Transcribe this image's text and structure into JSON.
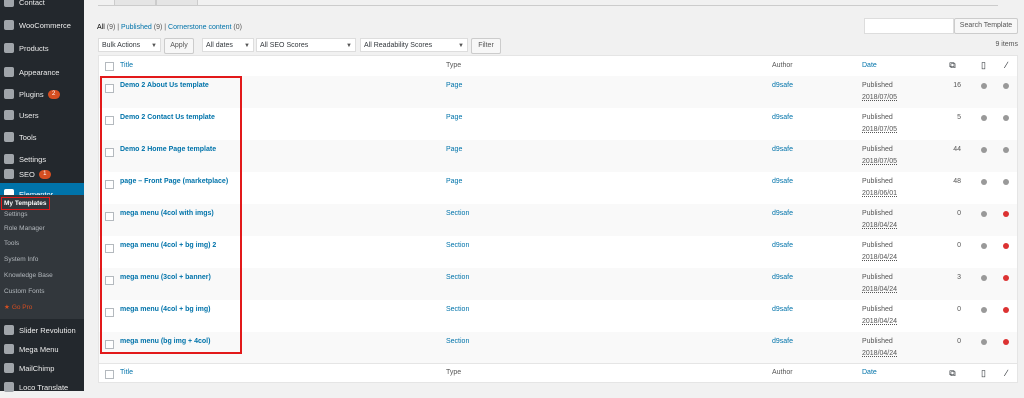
{
  "sidebar": {
    "items": [
      {
        "label": "Contact",
        "name": "sidebar-item-contact",
        "icon": "mail-icon"
      },
      {
        "label": "WooCommerce",
        "name": "sidebar-item-woocommerce",
        "icon": "woocommerce-icon"
      },
      {
        "label": "Products",
        "name": "sidebar-item-products",
        "icon": "archive-icon"
      },
      {
        "label": "Appearance",
        "name": "sidebar-item-appearance",
        "icon": "brush-icon"
      },
      {
        "label": "Plugins",
        "name": "sidebar-item-plugins",
        "icon": "plug-icon",
        "badge": "2"
      },
      {
        "label": "Users",
        "name": "sidebar-item-users",
        "icon": "user-icon"
      },
      {
        "label": "Tools",
        "name": "sidebar-item-tools",
        "icon": "wrench-icon"
      },
      {
        "label": "Settings",
        "name": "sidebar-item-settings",
        "icon": "settings-icon"
      },
      {
        "label": "SEO",
        "name": "sidebar-item-seo",
        "icon": "yoast-icon",
        "badge": "1"
      },
      {
        "label": "Elementor",
        "name": "sidebar-item-elementor",
        "icon": "elementor-icon",
        "active": true
      }
    ],
    "submenu": [
      "My Templates",
      "Settings",
      "Role Manager",
      "Tools",
      "System Info",
      "Knowledge Base",
      "Custom Fonts",
      "Go Pro"
    ],
    "bottom_items": [
      {
        "label": "Slider Revolution",
        "icon": "slider-icon"
      },
      {
        "label": "Mega Menu",
        "icon": "megamenu-icon"
      },
      {
        "label": "MailChimp",
        "icon": "mailchimp-icon"
      },
      {
        "label": "Loco Translate",
        "icon": "translate-icon"
      }
    ]
  },
  "filters_links": {
    "all": "All",
    "all_count": "(9)",
    "sep1": "|",
    "published": "Published",
    "published_count": "(9)",
    "sep2": "|",
    "cornerstone": "Cornerstone content",
    "cornerstone_count": "(0)"
  },
  "toolbar": {
    "bulk_actions": "Bulk Actions",
    "apply": "Apply",
    "dates": "All dates",
    "seo": "All SEO Scores",
    "readability": "All Readability Scores",
    "filter": "Filter",
    "search_button": "Search Template",
    "items_count": "9 items"
  },
  "table": {
    "columns": {
      "title": "Title",
      "type": "Type",
      "author": "Author",
      "date": "Date"
    },
    "rows": [
      {
        "title": "Demo 2 About Us template",
        "type": "Page",
        "author": "d9safe",
        "status": "Published",
        "date": "2018/07/05",
        "links": "16",
        "seo": "#999999",
        "read": "#999999"
      },
      {
        "title": "Demo 2 Contact Us template",
        "type": "Page",
        "author": "d9safe",
        "status": "Published",
        "date": "2018/07/05",
        "links": "5",
        "seo": "#999999",
        "read": "#999999"
      },
      {
        "title": "Demo 2 Home Page template",
        "type": "Page",
        "author": "d9safe",
        "status": "Published",
        "date": "2018/07/05",
        "links": "44",
        "seo": "#999999",
        "read": "#999999"
      },
      {
        "title": "page – Front Page (marketplace)",
        "type": "Page",
        "author": "d9safe",
        "status": "Published",
        "date": "2018/06/01",
        "links": "48",
        "seo": "#999999",
        "read": "#999999"
      },
      {
        "title": "mega menu (4col with imgs)",
        "type": "Section",
        "author": "d9safe",
        "status": "Published",
        "date": "2018/04/24",
        "links": "0",
        "seo": "#999999",
        "read": "#dc3232"
      },
      {
        "title": "mega menu (4col + bg img) 2",
        "type": "Section",
        "author": "d9safe",
        "status": "Published",
        "date": "2018/04/24",
        "links": "0",
        "seo": "#999999",
        "read": "#dc3232"
      },
      {
        "title": "mega menu (3col + banner)",
        "type": "Section",
        "author": "d9safe",
        "status": "Published",
        "date": "2018/04/24",
        "links": "3",
        "seo": "#999999",
        "read": "#dc3232"
      },
      {
        "title": "mega menu (4col + bg img)",
        "type": "Section",
        "author": "d9safe",
        "status": "Published",
        "date": "2018/04/24",
        "links": "0",
        "seo": "#999999",
        "read": "#dc3232"
      },
      {
        "title": "mega menu (bg img + 4col)",
        "type": "Section",
        "author": "d9safe",
        "status": "Published",
        "date": "2018/04/24",
        "links": "0",
        "seo": "#999999",
        "read": "#dc3232"
      }
    ]
  },
  "colors": {
    "accent": "#0073aa",
    "sidebar_bg": "#23282d",
    "highlight": "#e2191a"
  }
}
